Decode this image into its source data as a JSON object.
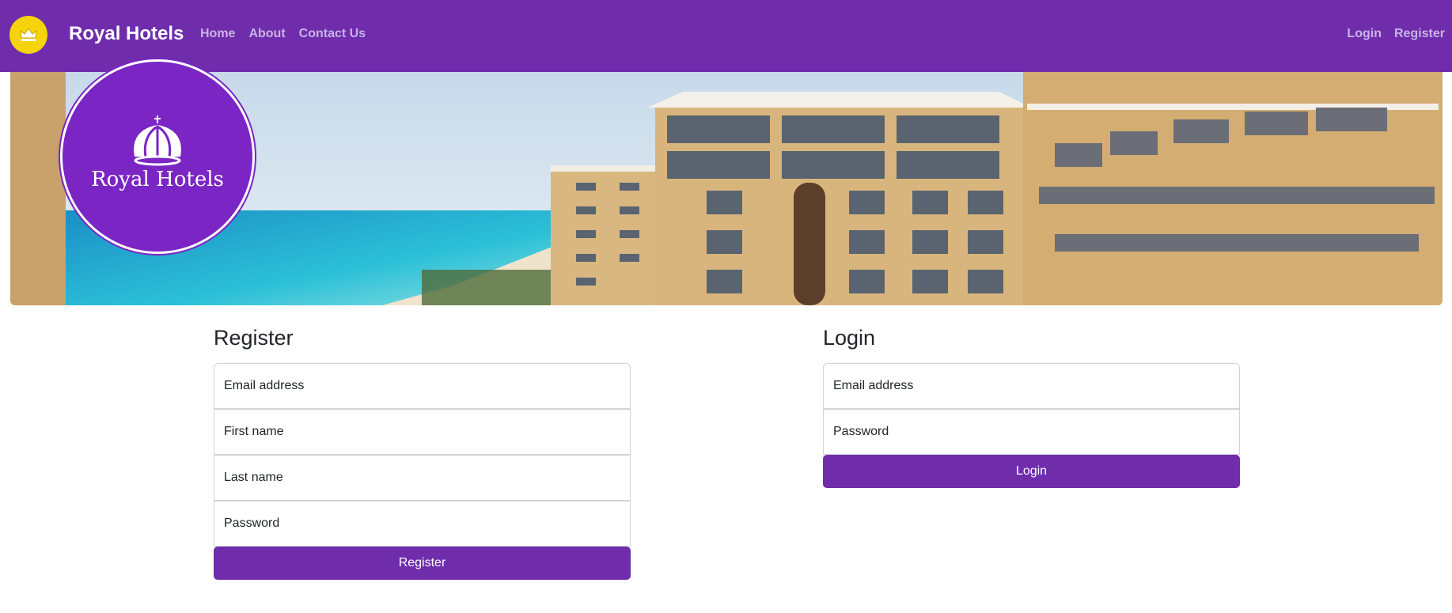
{
  "navbar": {
    "logo_icon": "crown-logo-icon",
    "brand": "Royal Hotels",
    "links_left": [
      "Home",
      "About",
      "Contact Us"
    ],
    "links_right": [
      "Login",
      "Register"
    ],
    "colors": {
      "bar": "#6f2dab",
      "logo": "#f5d40b"
    }
  },
  "hero": {
    "image": "beach-resort-hotel-photo",
    "emblem_icon": "crown-icon",
    "emblem_title": "Royal Hotels"
  },
  "register": {
    "title": "Register",
    "fields": [
      "Email address",
      "First name",
      "Last name",
      "Password"
    ],
    "button": "Register"
  },
  "login": {
    "title": "Login",
    "fields": [
      "Email address",
      "Password"
    ],
    "button": "Login"
  }
}
